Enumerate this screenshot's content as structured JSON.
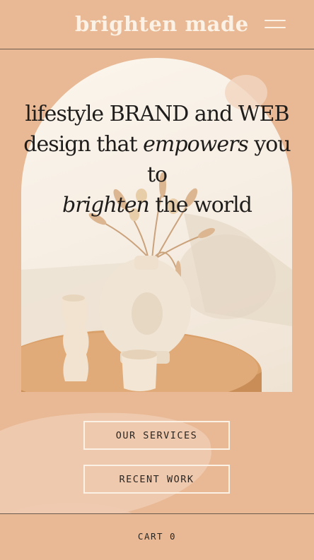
{
  "header": {
    "logo": "brighten made",
    "menu_icon": "hamburger-menu-icon"
  },
  "hero": {
    "headline": {
      "line1": "lifestyle BRAND and WEB",
      "line2_pre": "design that ",
      "line2_em": "empowers",
      "line2_post": " you to",
      "line3_em": "brighten",
      "line3_post": " the world"
    },
    "image_subject": "ceramic vases with dried pampas grass on wooden table"
  },
  "buttons": {
    "services": "OUR SERVICES",
    "work": "RECENT WORK"
  },
  "footer": {
    "cart": "CART 0"
  },
  "colors": {
    "background": "#e8b994",
    "logo": "#fbf1e4",
    "text": "#1f1d1b",
    "button_border": "#fbf1e4"
  }
}
